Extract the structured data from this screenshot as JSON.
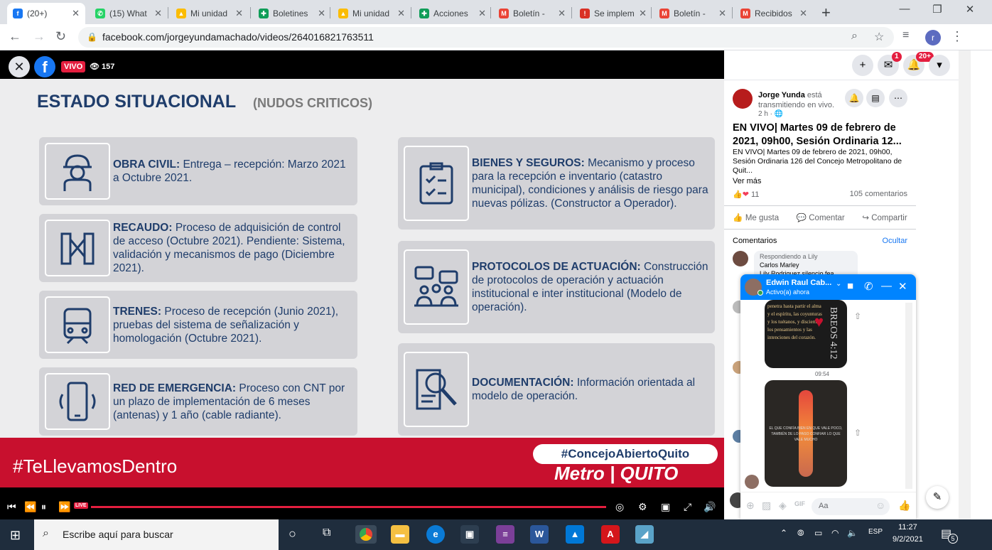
{
  "browser": {
    "tabs": [
      {
        "label": "(20+)",
        "icon": "facebook-icon",
        "color": "#1877f2",
        "active": true
      },
      {
        "label": "(15) What",
        "icon": "whatsapp-icon",
        "color": "#25d366"
      },
      {
        "label": "Mi unidad",
        "icon": "drive-icon",
        "color": "#fbbc04"
      },
      {
        "label": "Boletines",
        "icon": "sheets-icon",
        "color": "#0f9d58"
      },
      {
        "label": "Mi unidad",
        "icon": "drive-icon",
        "color": "#fbbc04"
      },
      {
        "label": "Acciones",
        "icon": "sheets-icon",
        "color": "#0f9d58"
      },
      {
        "label": "Boletín -",
        "icon": "gmail-icon",
        "color": "#ea4335"
      },
      {
        "label": "Se implem",
        "icon": "alert-icon",
        "color": "#d93025"
      },
      {
        "label": "Boletín -",
        "icon": "gmail-icon",
        "color": "#ea4335"
      },
      {
        "label": "Recibidos",
        "icon": "gmail-icon",
        "color": "#ea4335"
      }
    ],
    "url": "facebook.com/jorgeyundamachado/videos/264016821763511",
    "profile_initial": "r"
  },
  "video": {
    "live_label": "VIVO",
    "viewers": "157",
    "slide": {
      "title": "ESTADO SITUACIONAL",
      "subtitle": "(NUDOS CRITICOS)",
      "left_cards": [
        {
          "icon": "worker-icon",
          "heading": "OBRA CIVIL:",
          "text": " Entrega – recepción: Marzo 2021 a Octubre 2021."
        },
        {
          "icon": "turnstile-icon",
          "heading": "RECAUDO:",
          "text": " Proceso de adquisición de control de acceso (Octubre 2021). Pendiente: Sistema, validación y mecanismos de pago (Diciembre 2021)."
        },
        {
          "icon": "train-icon",
          "heading": "TRENES:",
          "text": " Proceso de recepción (Junio 2021), pruebas del sistema de señalización y homologación (Octubre 2021)."
        },
        {
          "icon": "phone-signal-icon",
          "heading": "RED DE EMERGENCIA:",
          "text": " Proceso con CNT por un plazo de implementación de 6 meses (antenas) y 1 año (cable radiante)."
        }
      ],
      "right_cards": [
        {
          "icon": "checklist-icon",
          "heading": "BIENES Y SEGUROS:",
          "text": " Mecanismo y proceso para la recepción e inventario (catastro municipal), condiciones y análisis de riesgo para nuevas pólizas. (Constructor a Operador)."
        },
        {
          "icon": "meeting-icon",
          "heading": "PROTOCOLOS DE ACTUACIÓN:",
          "text": " Construcción de protocolos de operación y actuación institucional e inter institucional (Modelo de operación)."
        },
        {
          "icon": "document-search-icon",
          "heading": "DOCUMENTACIÓN:",
          "text": " Información orientada al modelo de operación."
        }
      ],
      "hashtag_left": "#TeLlevamosDentro",
      "hashtag_right": "#ConcejoAbiertoQuito",
      "logo_text": "Metro | QUITO"
    },
    "controls": {
      "live_badge": "LIVE"
    }
  },
  "facebook": {
    "badges": {
      "messenger": "1",
      "notifications": "20+"
    },
    "post": {
      "author": "Jorge Yunda",
      "author_suffix": " está transmitiendo en vivo.",
      "time": "2 h · ",
      "title": "EN VIVO| Martes 09 de febrero de 2021, 09h00, Sesión Ordinaria 12...",
      "description": "EN VIVO| Martes 09 de febrero de 2021, 09h00, Sesión Ordinaria 126 del Concejo Metropolitano de Quit...",
      "ver_mas": "Ver más",
      "reactions_count": "11",
      "comments_count": "105 comentarios",
      "like": "Me gusta",
      "comment": "Comentar",
      "share": "Compartir"
    },
    "comments_header": "Comentarios",
    "hide": "Ocultar",
    "comment_preview": {
      "replying": "Respondiendo a Lily",
      "name": "Carlos Marley",
      "text": "Lily Rodriguez silencio fea"
    },
    "chat": {
      "name": "Edwin Raul Cab...",
      "status": "Activo(a) ahora",
      "time": "09:54",
      "image1_text": "penetra hasta partir el alma y el espíritu, las coyunturas y los tuétanos, y discierne los pensamientos y las intenciones del corazón.",
      "image1_verse": "BREOS 4:12",
      "image2_text": "EL QUE CONFÍA BIEN EN QUE VALE POCO, TAMBIÉN DE LO PASO CONFIAR LO QUE VALE MUCHO",
      "input_placeholder": "Aa"
    }
  },
  "taskbar": {
    "search_placeholder": "Escribe aquí para buscar",
    "lang": "ESP",
    "time": "11:27",
    "date": "9/2/2021",
    "notifications": "5"
  }
}
